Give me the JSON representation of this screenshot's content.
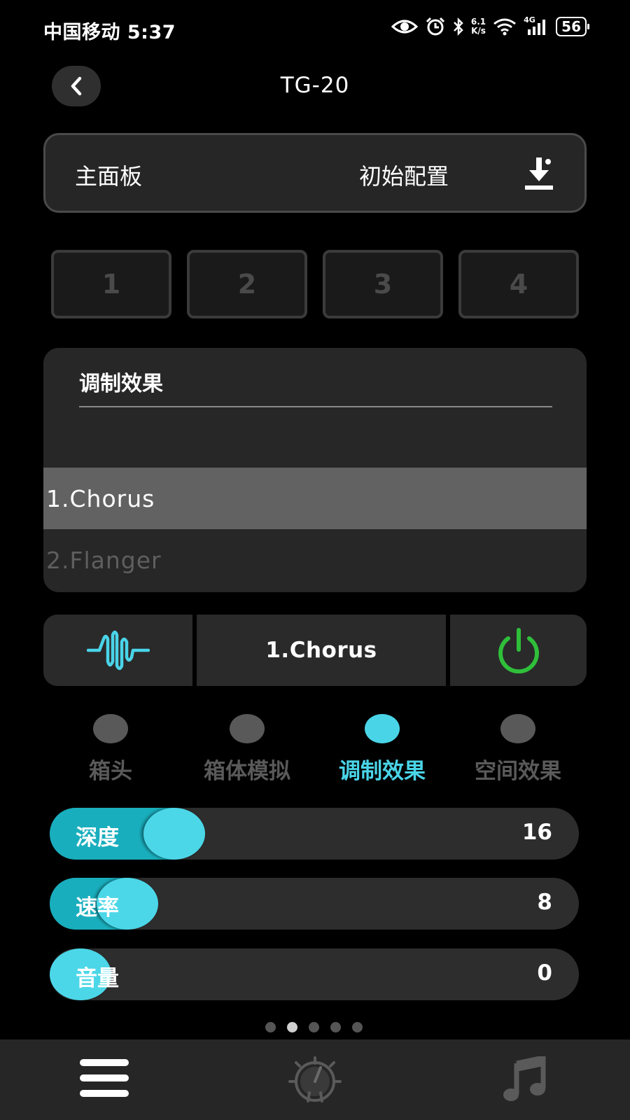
{
  "status_bar": {
    "carrier_time": "中国移动 5:37",
    "net_speed_value": "6.1",
    "net_speed_unit": "K/s",
    "network_type": "4G",
    "battery": "56"
  },
  "header": {
    "title": "TG-20",
    "back_icon": "chevron-left-icon"
  },
  "preset": {
    "label": "主面板",
    "config_label": "初始配置",
    "download_icon": "download-icon"
  },
  "slots": [
    "1",
    "2",
    "3",
    "4"
  ],
  "effect_panel": {
    "heading": "调制效果",
    "items": [
      "1.Chorus",
      "2.Flanger"
    ],
    "selected_index": 0
  },
  "control": {
    "current_effect": "1.Chorus",
    "wave_icon": "waveform-icon",
    "power_icon": "power-icon",
    "power_on": true,
    "colors": {
      "wave": "#4ad4e8",
      "power": "#2fbf3a"
    }
  },
  "tabs": [
    {
      "label": "箱头",
      "active": false
    },
    {
      "label": "箱体模拟",
      "active": false
    },
    {
      "label": "调制效果",
      "active": true
    },
    {
      "label": "空间效果",
      "active": false
    }
  ],
  "sliders": [
    {
      "label": "深度",
      "value": "16",
      "level": 0.2
    },
    {
      "label": "速率",
      "value": "8",
      "level": 0.1
    },
    {
      "label": "音量",
      "value": "0",
      "level": 0.0
    }
  ],
  "pager": {
    "count": 5,
    "active": 1
  },
  "bottom_nav": {
    "menu_icon": "menu-icon",
    "tuner_icon": "tuner-icon",
    "music_icon": "music-note-icon"
  },
  "colors": {
    "accent": "#4ad4e8",
    "slider_fill": "#19aebd",
    "background": "#000000"
  }
}
